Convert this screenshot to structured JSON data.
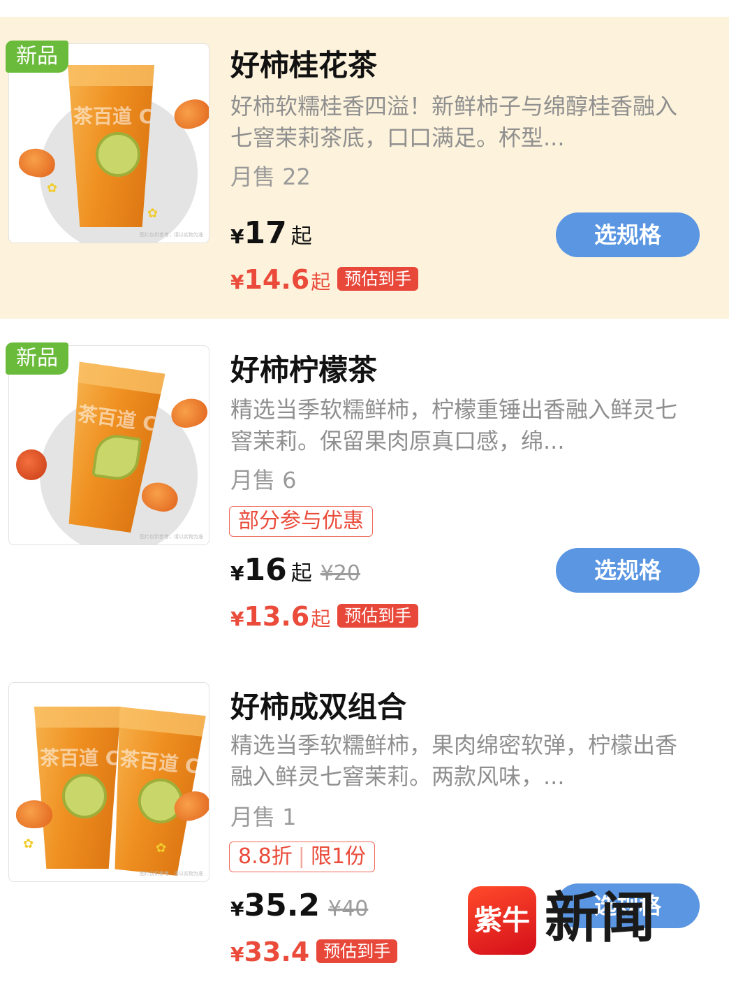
{
  "products": [
    {
      "badge": "新品",
      "title": "好柿桂花茶",
      "description": "好柿软糯桂香四溢！新鲜柿子与绵醇桂香融入七窨茉莉茶底，口口满足。杯型...",
      "sales": "月售 22",
      "promo_tag": "",
      "price_currency": "¥",
      "price": "17",
      "price_suffix": "起",
      "original_price": "",
      "est_currency": "¥",
      "est_price": "14.6",
      "est_suffix": "起",
      "est_label": "预估到手",
      "button_label": "选规格",
      "image_logo_text": "茶百道 Cha",
      "image_disclaimer": "图片仅供参考，请以实物为准",
      "highlighted": true
    },
    {
      "badge": "新品",
      "title": "好柿柠檬茶",
      "description": "精选当季软糯鲜柿，柠檬重锤出香融入鲜灵七窨茉莉。保留果肉原真口感，绵...",
      "sales": "月售 6",
      "promo_tag": "部分参与优惠",
      "price_currency": "¥",
      "price": "16",
      "price_suffix": "起",
      "original_price": "¥20",
      "est_currency": "¥",
      "est_price": "13.6",
      "est_suffix": "起",
      "est_label": "预估到手",
      "button_label": "选规格",
      "image_logo_text": "茶百道 Cha",
      "image_disclaimer": "图片仅供参考，请以实物为准",
      "highlighted": false
    },
    {
      "badge": "",
      "title": "好柿成双组合",
      "description": "精选当季软糯鲜柿，果肉绵密软弹，柠檬出香融入鲜灵七窨茉莉。两款风味，...",
      "sales": "月售 1",
      "promo_tag_parts": [
        "8.8折",
        "限1份"
      ],
      "price_currency": "¥",
      "price": "35.2",
      "price_suffix": "",
      "original_price": "¥40",
      "est_currency": "¥",
      "est_price": "33.4",
      "est_suffix": "",
      "est_label": "预估到手",
      "button_label": "选规格",
      "image_logo_text": "茶百道 Cha",
      "image_disclaimer": "图片仅供参考，请以实物为准",
      "highlighted": false
    }
  ],
  "watermark": {
    "logo_text": "紫牛",
    "text": "新闻"
  },
  "colors": {
    "highlight_bg": "#fdf3dc",
    "new_badge": "#6abb3b",
    "button": "#5a96e2",
    "price_red": "#ea4b3a"
  }
}
